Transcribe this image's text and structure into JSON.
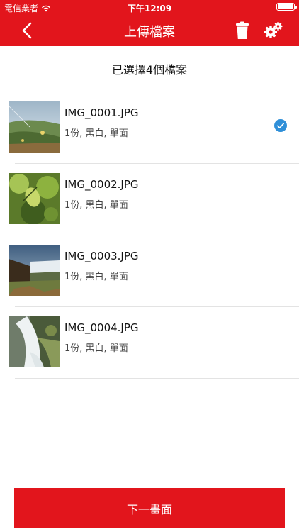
{
  "status_bar": {
    "carrier": "電信業者",
    "time": "下午12:09",
    "battery_level": 1.0
  },
  "nav": {
    "title": "上傳檔案",
    "back_icon": "chevron-left-icon",
    "trash_icon": "trash-icon",
    "settings_icon": "gears-icon"
  },
  "header": {
    "selected_text": "已選擇4個檔案"
  },
  "files": [
    {
      "name": "IMG_0001.JPG",
      "meta": "1份, 黑白, 單面",
      "selected": true
    },
    {
      "name": "IMG_0002.JPG",
      "meta": "1份, 黑白, 單面",
      "selected": false
    },
    {
      "name": "IMG_0003.JPG",
      "meta": "1份, 黑白, 單面",
      "selected": false
    },
    {
      "name": "IMG_0004.JPG",
      "meta": "1份, 黑白, 單面",
      "selected": false
    }
  ],
  "footer": {
    "next_label": "下一畫面"
  },
  "colors": {
    "accent": "#e2151c",
    "check": "#2f8fd8",
    "divider": "#e3e3e3"
  }
}
